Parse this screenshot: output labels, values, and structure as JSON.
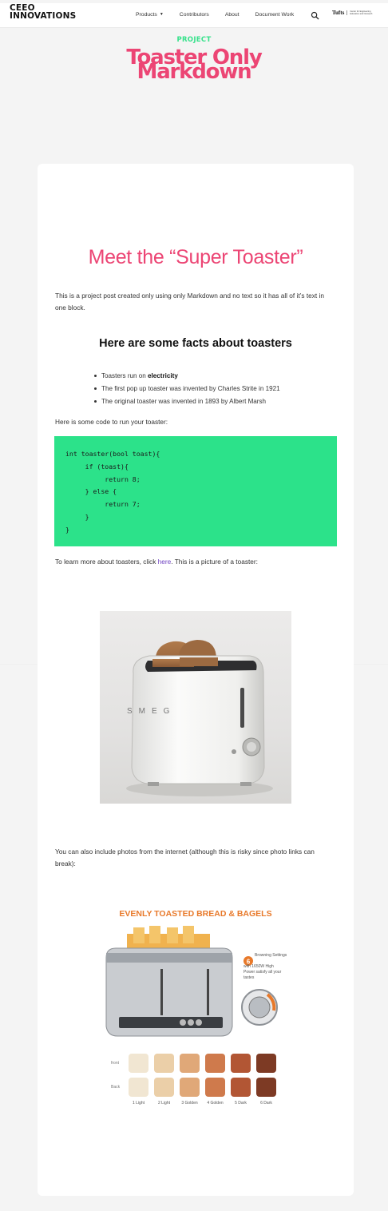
{
  "nav": {
    "logo_line1": "CEEO",
    "logo_line2": "INNOVATIONS",
    "products": "Products",
    "contributors": "Contributors",
    "about": "About",
    "document_work": "Document Work",
    "tufts_word": "Tufts",
    "tufts_sub": "Center for Engineering Education and Outreach"
  },
  "hero": {
    "eyebrow": "PROJECT",
    "title_line1": "Toaster Only",
    "title_line2": "Markdown"
  },
  "article": {
    "heading": "Meet the “Super Toaster”",
    "intro": "This is a project post created only using only Markdown and no text so it has all of it’s text in one block.",
    "facts_heading": "Here are some facts about toasters",
    "facts": [
      {
        "prefix": "Toasters run on ",
        "bold": "electricity"
      },
      {
        "text": "The first pop up toaster was invented by Charles Strite in 1921"
      },
      {
        "text": "The original toaster was invented in 1893 by Albert Marsh"
      }
    ],
    "code_intro": "Here is some code to run your toaster:",
    "code": "int toaster(bool toast){\n     if (toast){\n          return 8;\n     } else {\n          return 7;\n     }\n}",
    "learn_prefix": "To learn more about toasters, click ",
    "learn_link": "here",
    "learn_suffix": ". This is a picture of a toaster:",
    "internet_text": "You can also include photos from the internet (although this is risky since photo links can break):",
    "infographic": {
      "title": "EVENLY TOASTED BREAD & BAGELS",
      "badge_number": "6",
      "badge_text_1": "Browning Settings",
      "badge_text_2": "with 1650W High",
      "badge_text_3": "Power satisfy all your",
      "badge_text_4": "tastes",
      "row_front": "front",
      "row_back": "Back",
      "levels": [
        "1 Light",
        "2 Light",
        "3 Golden",
        "4 Golden",
        "5 Dark",
        "6 Dark"
      ],
      "shade_colors": [
        "#f1e6d2",
        "#ebcfa8",
        "#e0a878",
        "#cf7a4c",
        "#b25634",
        "#7d3a24"
      ]
    }
  },
  "colors": {
    "accent_pink": "#ec4574",
    "accent_green": "#36e28b",
    "code_bg": "#2ce28a",
    "link": "#6f42c1"
  },
  "icons": [
    "search-icon",
    "caret-down-icon"
  ]
}
